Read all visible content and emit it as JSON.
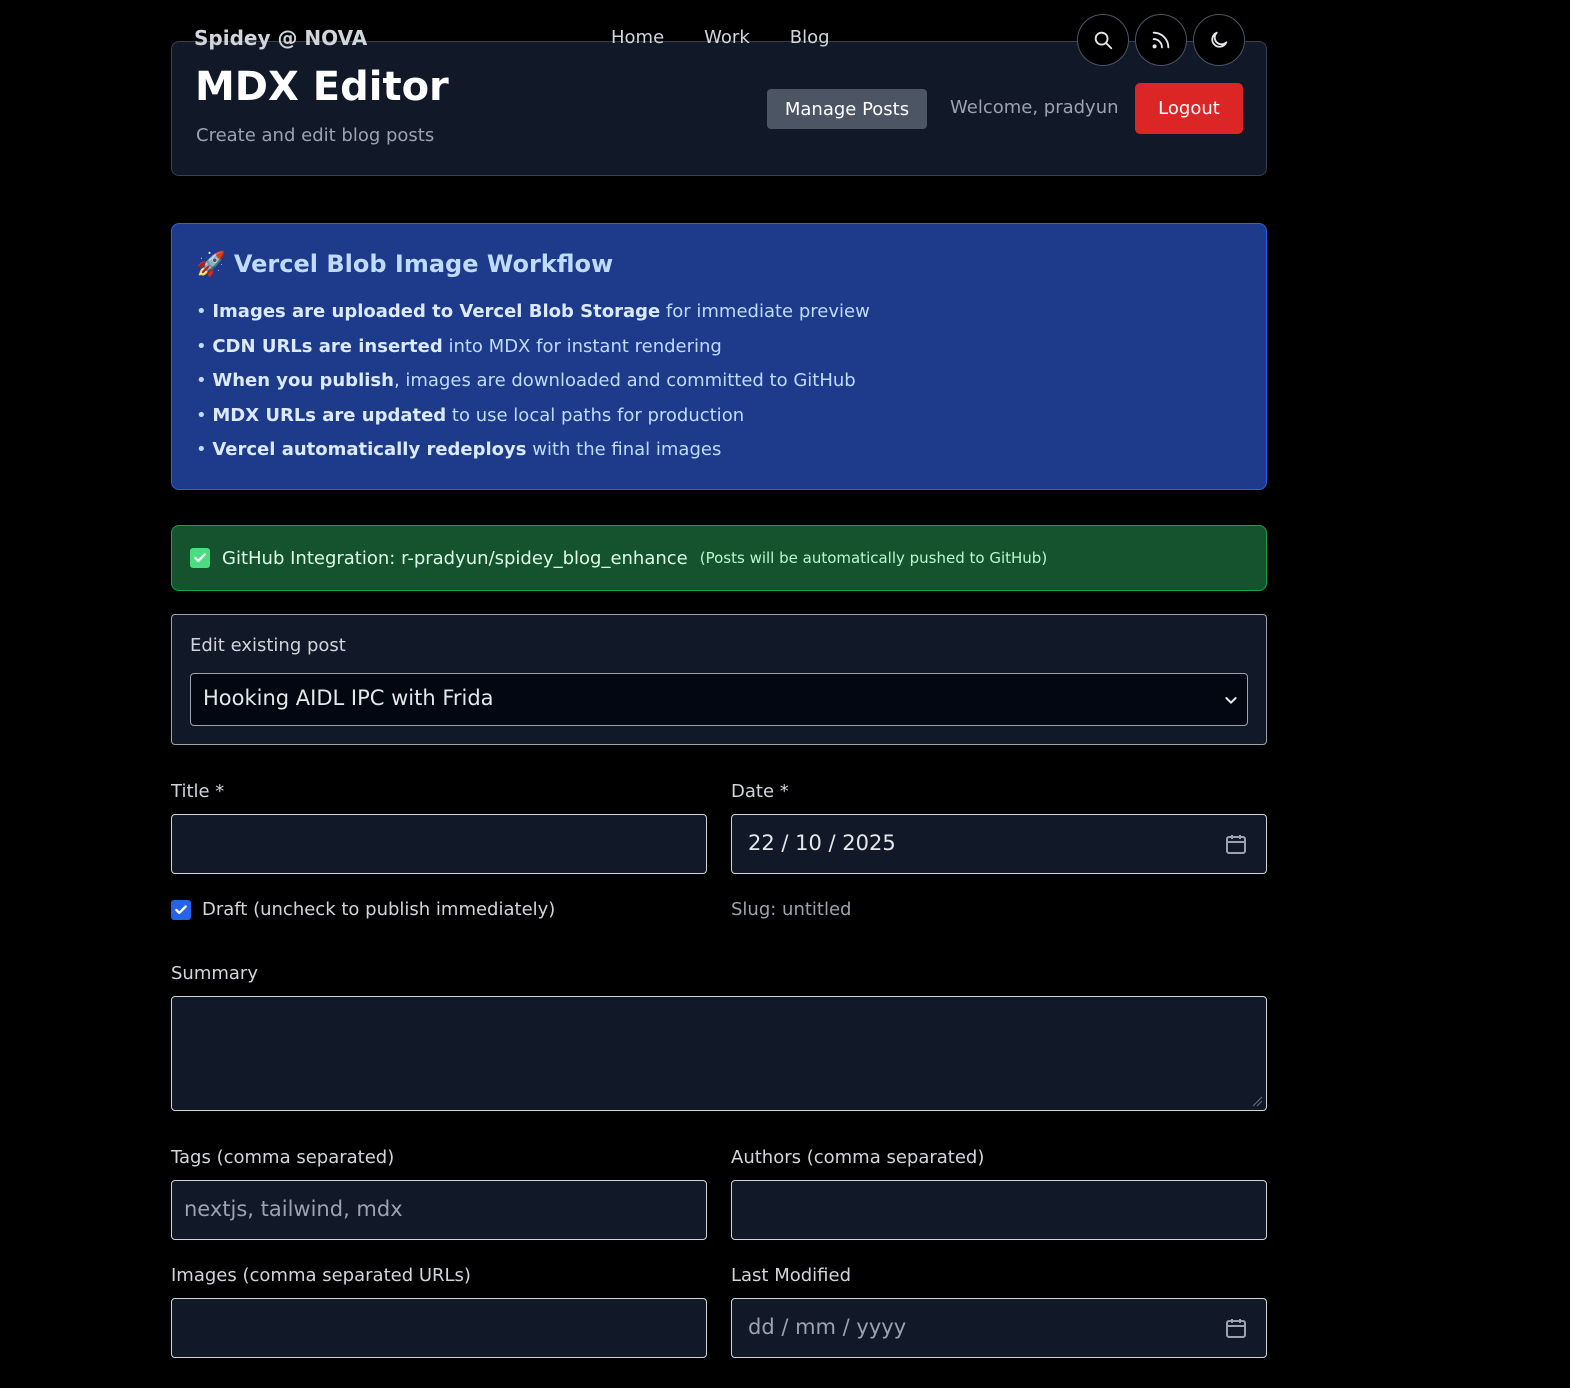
{
  "topbar": {
    "brand": "Spidey @ NOVA",
    "nav": [
      "Home",
      "Work",
      "Blog"
    ],
    "icons": [
      "search-icon",
      "rss-icon",
      "moon-icon"
    ]
  },
  "header": {
    "title": "MDX Editor",
    "subtitle": "Create and edit blog posts",
    "manage_label": "Manage Posts",
    "welcome": "Welcome, pradyun",
    "logout_label": "Logout"
  },
  "workflow": {
    "emoji": "🚀",
    "title": "Vercel Blob Image Workflow",
    "items": [
      {
        "bold": "Images are uploaded to Vercel Blob Storage",
        "rest": " for immediate preview"
      },
      {
        "bold": "CDN URLs are inserted",
        "rest": " into MDX for instant rendering"
      },
      {
        "bold": "When you publish",
        "rest": ", images are downloaded and committed to GitHub"
      },
      {
        "bold": "MDX URLs are updated",
        "rest": " to use local paths for production"
      },
      {
        "bold": "Vercel automatically redeploys",
        "rest": " with the final images"
      }
    ]
  },
  "github": {
    "main": "GitHub Integration: r-pradyun/spidey_blog_enhance",
    "note": "(Posts will be automatically pushed to GitHub)"
  },
  "edit": {
    "label": "Edit existing post",
    "selected": "Hooking AIDL IPC with Frida"
  },
  "form": {
    "title_label": "Title *",
    "title_value": "",
    "date_label": "Date *",
    "date_value": "22 / 10 / 2025",
    "draft_label": "Draft (uncheck to publish immediately)",
    "slug": "Slug: untitled",
    "summary_label": "Summary",
    "tags_label": "Tags (comma separated)",
    "tags_placeholder": "nextjs, tailwind, mdx",
    "authors_label": "Authors (comma separated)",
    "images_label": "Images (comma separated URLs)",
    "lastmod_label": "Last Modified",
    "lastmod_placeholder": "dd / mm / yyyy"
  }
}
